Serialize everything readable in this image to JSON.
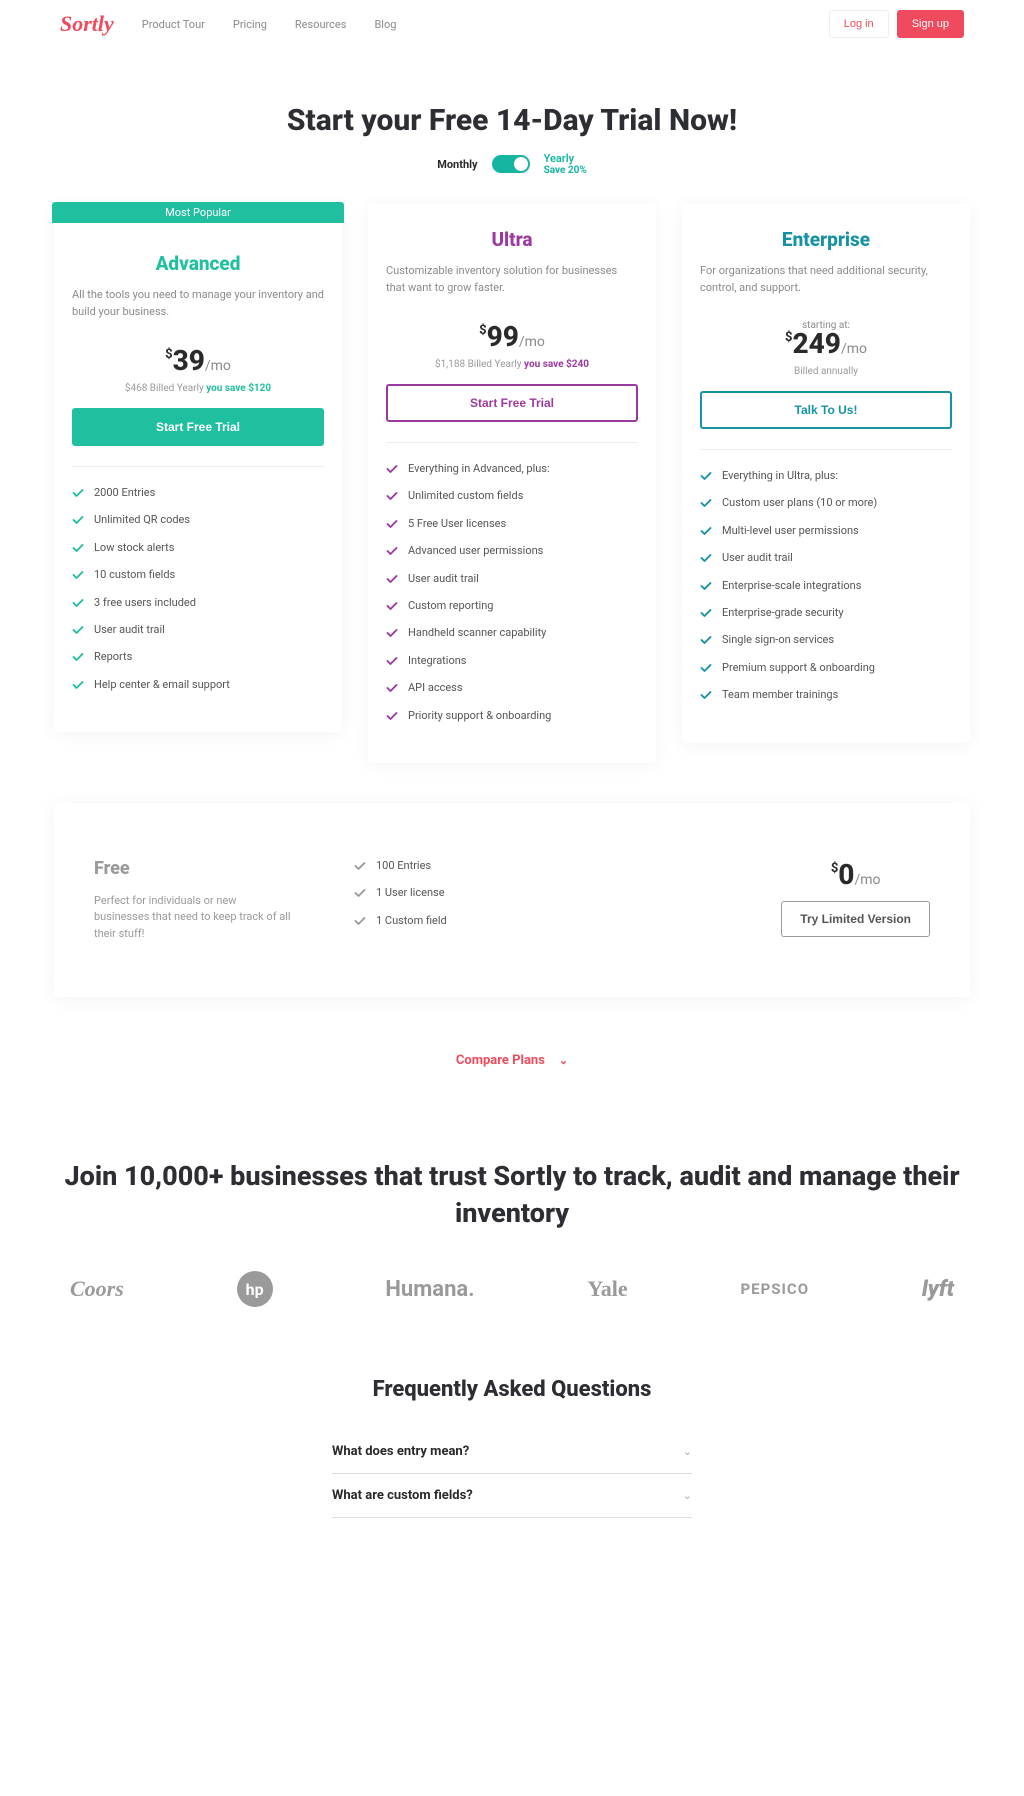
{
  "brand": "Sortly",
  "nav": {
    "tour": "Product Tour",
    "pricing": "Pricing",
    "resources": "Resources",
    "blog": "Blog"
  },
  "auth": {
    "login": "Log in",
    "signup": "Sign up"
  },
  "title": "Start your Free 14-Day Trial Now!",
  "toggle": {
    "monthly": "Monthly",
    "yearly": "Yearly",
    "save": "Save 20%"
  },
  "plans": {
    "advanced": {
      "badge": "Most Popular",
      "name": "Advanced",
      "sub": "All the tools you need to manage your inventory and build your business.",
      "price": "39",
      "per": "/mo",
      "bill": "$468 Billed Yearly ",
      "save": "you save $120",
      "cta": "Start Free Trial",
      "features": [
        "2000 Entries",
        "Unlimited QR codes",
        "Low stock alerts",
        "10 custom fields",
        "3 free users included",
        "User audit trail",
        "Reports",
        "Help center & email support"
      ]
    },
    "ultra": {
      "name": "Ultra",
      "sub": "Customizable inventory solution for businesses that want to grow faster.",
      "price": "99",
      "per": "/mo",
      "bill": "$1,188 Billed Yearly ",
      "save": "you save $240",
      "cta": "Start Free Trial",
      "features": [
        "Everything in Advanced, plus:",
        "Unlimited custom fields",
        "5 Free User licenses",
        "Advanced user permissions",
        "User audit trail",
        "Custom reporting",
        "Handheld scanner capability",
        "Integrations",
        "API access",
        "Priority support & onboarding"
      ]
    },
    "ent": {
      "name": "Enterprise",
      "sub": "For organizations that need additional security, control, and support.",
      "starting": "starting at:",
      "price": "249",
      "per": "/mo",
      "bill": "Billed annually",
      "cta": "Talk To Us!",
      "features": [
        "Everything in Ultra, plus:",
        "Custom user plans (10 or more)",
        "Multi-level user permissions",
        "User audit trail",
        "Enterprise-scale integrations",
        "Enterprise-grade security",
        "Single sign-on services",
        "Premium support & onboarding",
        "Team member trainings"
      ]
    },
    "free": {
      "name": "Free",
      "sub": "Perfect for individuals or new businesses that need to keep track of all their stuff!",
      "price": "0",
      "per": "/mo",
      "cta": "Try Limited Version",
      "features": [
        "100 Entries",
        "1 User license",
        "1 Custom field"
      ]
    }
  },
  "compare": "Compare Plans",
  "trust_heading": "Join 10,000+ businesses that trust Sortly to track, audit and manage their inventory",
  "logos": [
    "Coors",
    "hp",
    "Humana.",
    "Yale",
    "PEPSICO",
    "lyft"
  ],
  "faq_heading": "Frequently Asked Questions",
  "faq": [
    {
      "q": "What does entry mean?"
    },
    {
      "q": "What are custom fields?"
    }
  ]
}
